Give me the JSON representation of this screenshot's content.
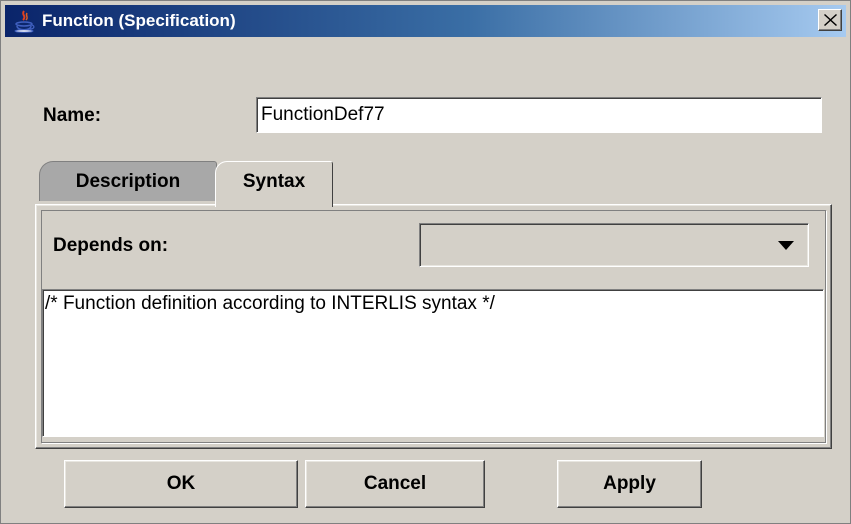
{
  "window": {
    "title": "Function (Specification)",
    "title_icon": "java-app-icon",
    "close_icon": "close-icon"
  },
  "form": {
    "name_label": "Name:",
    "name_value": "FunctionDef77"
  },
  "tabs": [
    {
      "label": "Description",
      "active": false
    },
    {
      "label": "Syntax",
      "active": true
    }
  ],
  "syntax_tab": {
    "depends_label": "Depends on:",
    "depends_value": "",
    "syntax_text": "/* Function definition according to INTERLIS syntax */"
  },
  "buttons": {
    "ok": "OK",
    "cancel": "Cancel",
    "apply": "Apply"
  },
  "colors": {
    "window_bg": "#d4d0c8",
    "titlebar_start": "#0a246a",
    "titlebar_end": "#a6caf0",
    "inactive_tab": "#a8a8a8"
  }
}
